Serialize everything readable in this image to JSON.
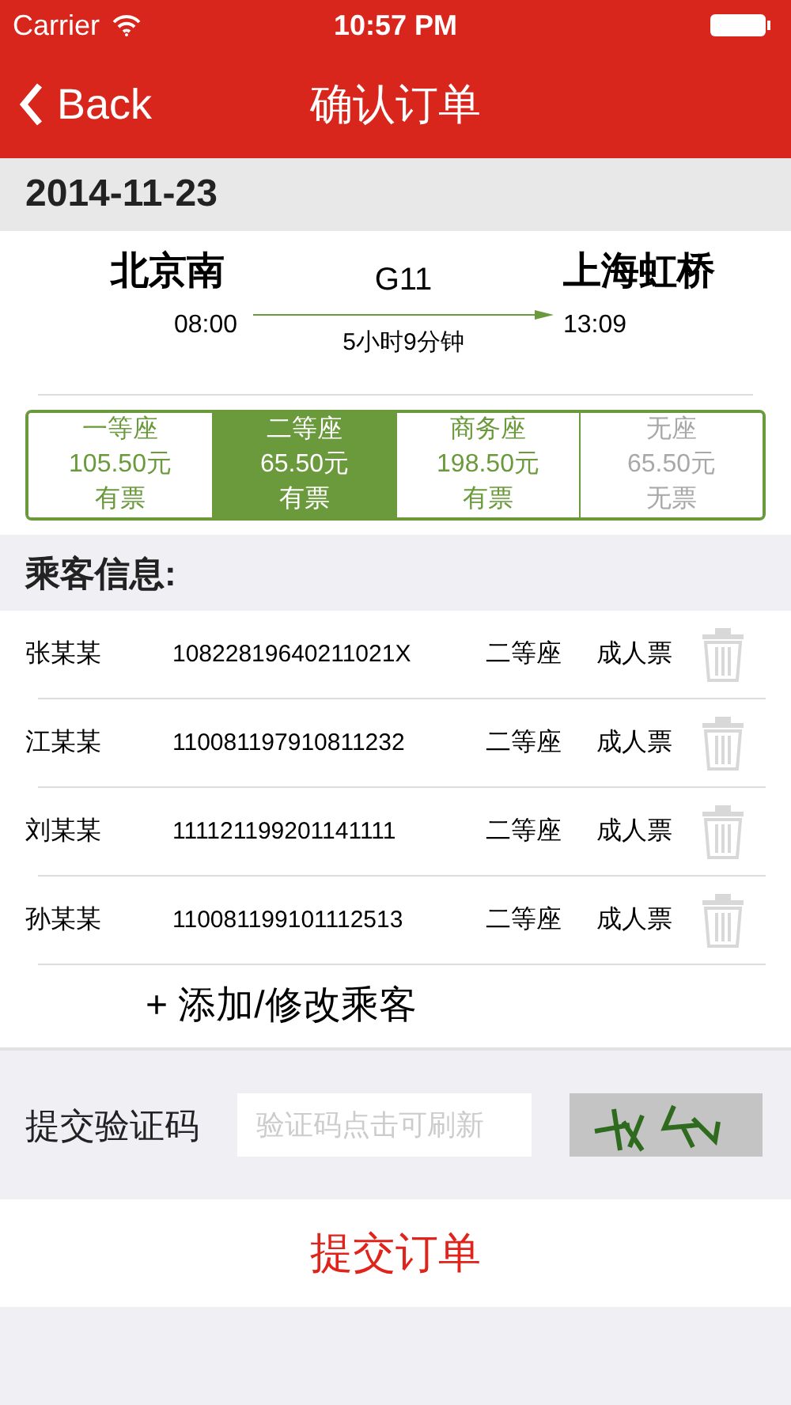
{
  "status_bar": {
    "carrier": "Carrier",
    "time": "10:57 PM"
  },
  "nav": {
    "back": "Back",
    "title": "确认订单"
  },
  "date": "2014-11-23",
  "trip": {
    "from": "北京南",
    "depart": "08:00",
    "train": "G11",
    "duration": "5小时9分钟",
    "to": "上海虹桥",
    "arrive": "13:09"
  },
  "seats": [
    {
      "name": "一等座",
      "price": "105.50元",
      "availability": "有票",
      "selected": false,
      "disabled": false
    },
    {
      "name": "二等座",
      "price": "65.50元",
      "availability": "有票",
      "selected": true,
      "disabled": false
    },
    {
      "name": "商务座",
      "price": "198.50元",
      "availability": "有票",
      "selected": false,
      "disabled": false
    },
    {
      "name": "无座",
      "price": "65.50元",
      "availability": "无票",
      "selected": false,
      "disabled": true
    }
  ],
  "passengers_heading": "乘客信息:",
  "passengers": [
    {
      "name": "张某某",
      "id": "10822819640211021X",
      "seat": "二等座",
      "ticket": "成人票"
    },
    {
      "name": "江某某",
      "id": "110081197910811232",
      "seat": "二等座",
      "ticket": "成人票"
    },
    {
      "name": "刘某某",
      "id": "111121199201141111",
      "seat": "二等座",
      "ticket": "成人票"
    },
    {
      "name": "孙某某",
      "id": "110081199101112513",
      "seat": "二等座",
      "ticket": "成人票"
    }
  ],
  "add_passenger": "+ 添加/修改乘客",
  "captcha": {
    "label": "提交验证码",
    "placeholder": "验证码点击可刷新"
  },
  "submit": "提交订单"
}
